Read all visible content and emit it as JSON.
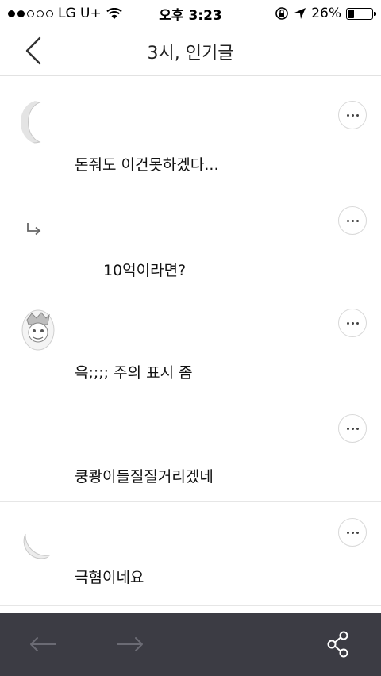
{
  "status_bar": {
    "carrier": "LG U+",
    "time": "오후 3:23",
    "battery_percent": "26%",
    "signal_bars_filled": 2,
    "signal_bars_total": 5,
    "battery_level": 0.26
  },
  "navbar": {
    "title": "3시, 인기글",
    "back_icon": "chevron-left-icon"
  },
  "comments": [
    {
      "text": "돈줘도 이건못하겠다...",
      "avatar": "moon-avatar"
    },
    {
      "text": "10억이라면?",
      "is_reply": true
    },
    {
      "text": "윽;;;; 주의 표시 좀",
      "avatar": "cartoon-avatar"
    },
    {
      "text": "쿵쾅이들질질거리겠네"
    },
    {
      "text": "극혐이네요",
      "avatar": "moon-avatar"
    }
  ],
  "bottom_bar": {
    "back_icon": "arrow-left-icon",
    "forward_icon": "arrow-right-icon",
    "share_icon": "share-icon"
  },
  "colors": {
    "bottom_bar_bg": "#3c3c44",
    "divider": "#e6e6e6",
    "icon_gray": "#6b6b74"
  }
}
